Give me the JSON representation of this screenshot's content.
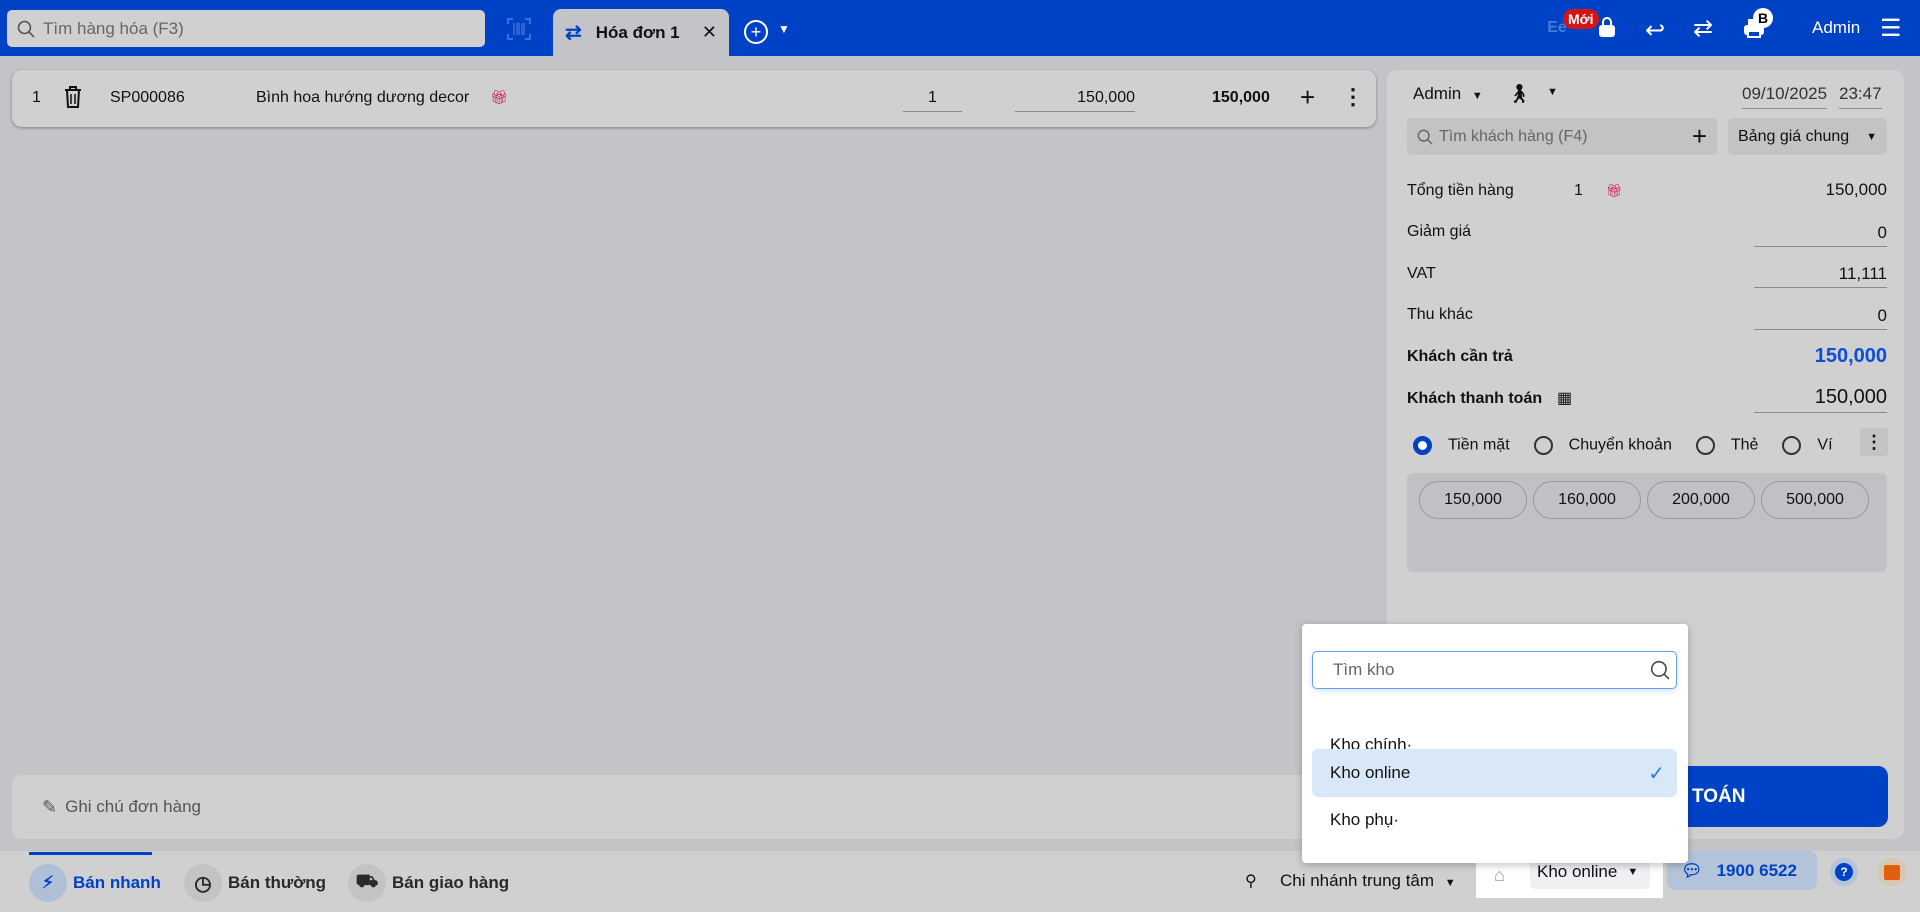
{
  "header": {
    "search_placeholder": "Tìm hàng hóa (F3)",
    "tab_label": "Hóa đơn 1",
    "new_badge": "Mới",
    "printer_badge": "B",
    "user": "Admin"
  },
  "item": {
    "index": "1",
    "code": "SP000086",
    "name": "Bình hoa hướng dương decor",
    "quantity": "1",
    "unit_price": "150,000",
    "total": "150,000"
  },
  "panel": {
    "seller": "Admin",
    "date": "09/10/2025",
    "time": "23:47",
    "customer_placeholder": "Tìm khách hàng (F4)",
    "price_list": "Bảng giá chung",
    "subtotal_label": "Tổng tiền hàng",
    "subtotal_count": "1",
    "subtotal": "150,000",
    "discount_label": "Giảm giá",
    "discount": "0",
    "vat_label": "VAT",
    "vat": "11,111",
    "other_label": "Thu khác",
    "other": "0",
    "due_label": "Khách cần trả",
    "due": "150,000",
    "paid_label": "Khách thanh toán",
    "paid": "150,000",
    "methods": [
      "Tiền mặt",
      "Chuyển khoản",
      "Thẻ",
      "Ví"
    ],
    "quick_amounts": [
      "150,000",
      "160,000",
      "200,000",
      "500,000"
    ],
    "pay_button": "THANH TOÁN",
    "pay_button_visible": "H TOÁN"
  },
  "note_placeholder": "Ghi chú đơn hàng",
  "bottom": {
    "modes": [
      "Bán nhanh",
      "Bán thường",
      "Bán giao hàng"
    ],
    "branch": "Chi nhánh trung tâm",
    "warehouse": "Kho online",
    "hotline": "1900 6522"
  },
  "dropdown": {
    "search_placeholder": "Tìm kho",
    "options": [
      "Kho chính·",
      "Kho online",
      "Kho phụ·"
    ],
    "selected": "Kho online"
  },
  "colors": {
    "brand": "#0042c6",
    "selected_option": "#d9e8f8"
  }
}
